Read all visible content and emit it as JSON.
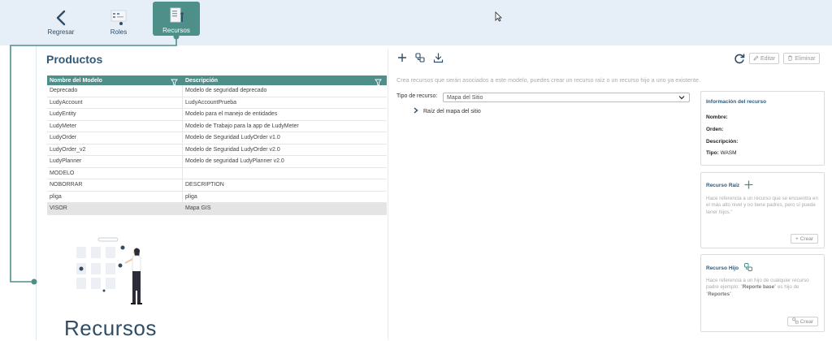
{
  "nav": {
    "back_label": "Regresar",
    "roles_label": "Roles",
    "resources_label": "Recursos"
  },
  "page": {
    "title": "Productos",
    "big_title": "Recursos"
  },
  "table": {
    "headers": [
      "Nombre del Modelo",
      "Descripción"
    ],
    "rows": [
      [
        "Deprecado",
        "Modelo de seguridad deprecado"
      ],
      [
        "LudyAccount",
        "LudyAccountPrueba"
      ],
      [
        "LudyEntity",
        "Modelo para el manejo de entidades"
      ],
      [
        "LudyMeter",
        "Modelo de Trabajo para la app de LudyMeter"
      ],
      [
        "LudyOrder",
        "Modelo de Seguridad LudyOrder v1.0"
      ],
      [
        "LudyOrder_v2",
        "Modelo de Seguridad LudyOrder v2.0"
      ],
      [
        "LudyPlanner",
        "Modelo de seguridad LudyPlanner v2.0"
      ],
      [
        "MODELO",
        ""
      ],
      [
        "NOBORRAR",
        "DESCRIPTION"
      ],
      [
        "pliga",
        "pliga"
      ],
      [
        "VISOR",
        "Mapa GIS"
      ]
    ],
    "selected_row": 10
  },
  "resources": {
    "hint": "Crea recursos que serán asociados a este modelo, puedes crear un recurso raíz o un recurso hijo a uno ya existente.",
    "type_label": "Tipo de recurso:",
    "type_value": "Mapa del Sitio",
    "tree_root": "Raíz del mapa del sitio",
    "edit_label": "Editar",
    "delete_label": "Eliminar"
  },
  "info_card": {
    "title": "Información del recurso",
    "name_label": "Nombre:",
    "order_label": "Orden:",
    "description_label": "Descripción:",
    "type_label": "Tipo:",
    "type_value": "WASM"
  },
  "root_card": {
    "title": "Recurso Raíz",
    "text": "Hace referencia a un recurso que se encuentra en el más alto nivel y no tiene padres, pero sí puede tener hijos.\"",
    "create_label": "Crear"
  },
  "child_card": {
    "title": "Recurso Hijo",
    "text_1": "Hace referencia a un hijo de cualquier recurso padre ejemplo: \"",
    "text_bold_1": "Reporte base",
    "text_2": "\" es hijo de \"",
    "text_bold_2": "Reportes",
    "text_3": "\".",
    "create_label": "Crear"
  },
  "icons": {
    "back": "chevron-left-icon",
    "roles": "roles-icon",
    "resources": "resources-icon",
    "add": "plus-icon",
    "add_child": "add-child-icon",
    "download": "download-icon",
    "refresh": "refresh-icon",
    "edit": "pencil-icon",
    "delete": "trash-icon",
    "filter": "filter-icon"
  },
  "colors": {
    "accent": "#4e8f8a",
    "title": "#2f5a7a",
    "topbar": "#e6eef7"
  }
}
